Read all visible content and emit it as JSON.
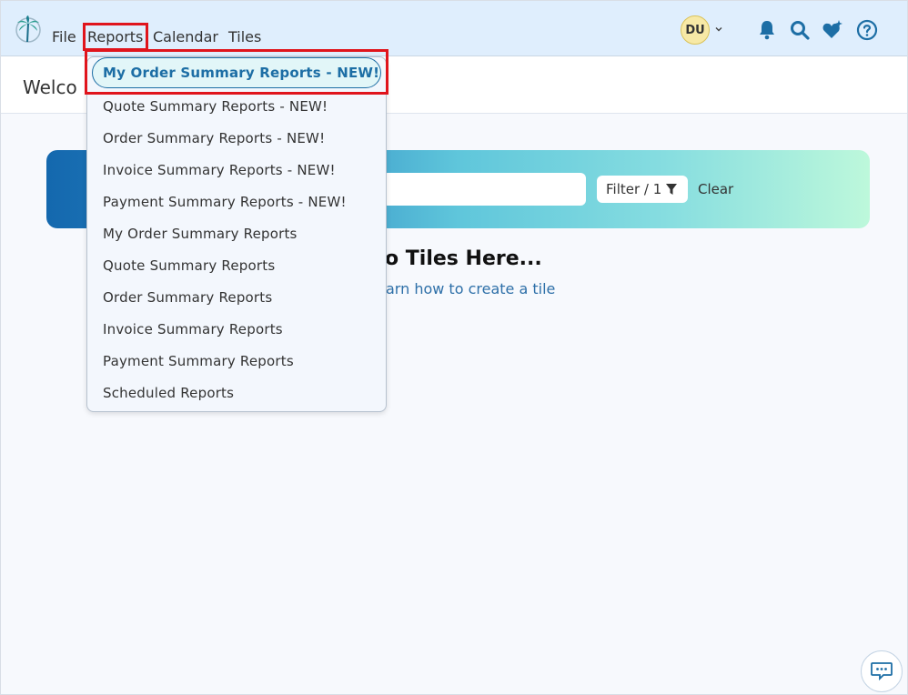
{
  "header": {
    "menu": {
      "file": "File",
      "reports": "Reports",
      "calendar": "Calendar",
      "tiles": "Tiles"
    },
    "avatar_initials": "DU",
    "icons": [
      "palm-tree-logo-icon",
      "bell-icon",
      "search-icon",
      "heart-sparkle-icon",
      "help-icon"
    ]
  },
  "welcome": {
    "text": "Welco"
  },
  "toolbar": {
    "filter_label": "Filter / 1",
    "clear_label": "Clear"
  },
  "empty_state": {
    "heading": "o Tiles Here...",
    "link": "arn how to create a tile"
  },
  "reports_menu": {
    "active_item": "My Order Summary Reports - NEW!",
    "items": [
      "Quote Summary Reports - NEW!",
      "Order Summary Reports - NEW!",
      "Invoice Summary Reports - NEW!",
      "Payment Summary Reports - NEW!",
      "My Order Summary Reports",
      "Quote Summary Reports",
      "Order Summary Reports",
      "Invoice Summary Reports",
      "Payment Summary Reports",
      "Scheduled Reports"
    ]
  },
  "colors": {
    "accent": "#1d6ea5",
    "highlight_red": "#e0141c",
    "header_bg": "#dfeefd"
  }
}
